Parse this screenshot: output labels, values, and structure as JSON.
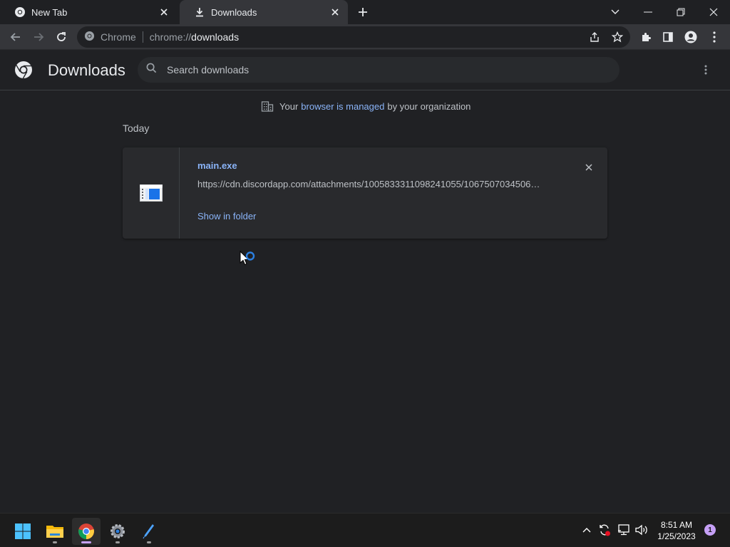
{
  "tabs": [
    {
      "title": "New Tab",
      "icon": "chrome-icon",
      "active": false
    },
    {
      "title": "Downloads",
      "icon": "download-icon",
      "active": true
    }
  ],
  "omnibox": {
    "chip": "Chrome",
    "url_scheme": "chrome://",
    "url_host": "downloads"
  },
  "downloads_page": {
    "title": "Downloads",
    "search_placeholder": "Search downloads",
    "managed_notice": {
      "prefix": "Your",
      "link": "browser is managed",
      "suffix": "by your organization"
    },
    "section_date": "Today",
    "items": [
      {
        "file_name": "main.exe",
        "url": "https://cdn.discordapp.com/attachments/1005833311098241055/1067507034506…",
        "action": "Show in folder"
      }
    ]
  },
  "taskbar": {
    "apps": [
      "start-icon",
      "file-explorer-icon",
      "chrome-icon",
      "settings-icon",
      "pen-app-icon"
    ],
    "clock_time": "8:51 AM",
    "clock_date": "1/25/2023",
    "notification_count": "1"
  },
  "colors": {
    "background": "#202124",
    "toolbar": "#35363a",
    "link": "#8ab4f8",
    "text": "#e8eaed",
    "taskbar": "#1c1c1c"
  }
}
